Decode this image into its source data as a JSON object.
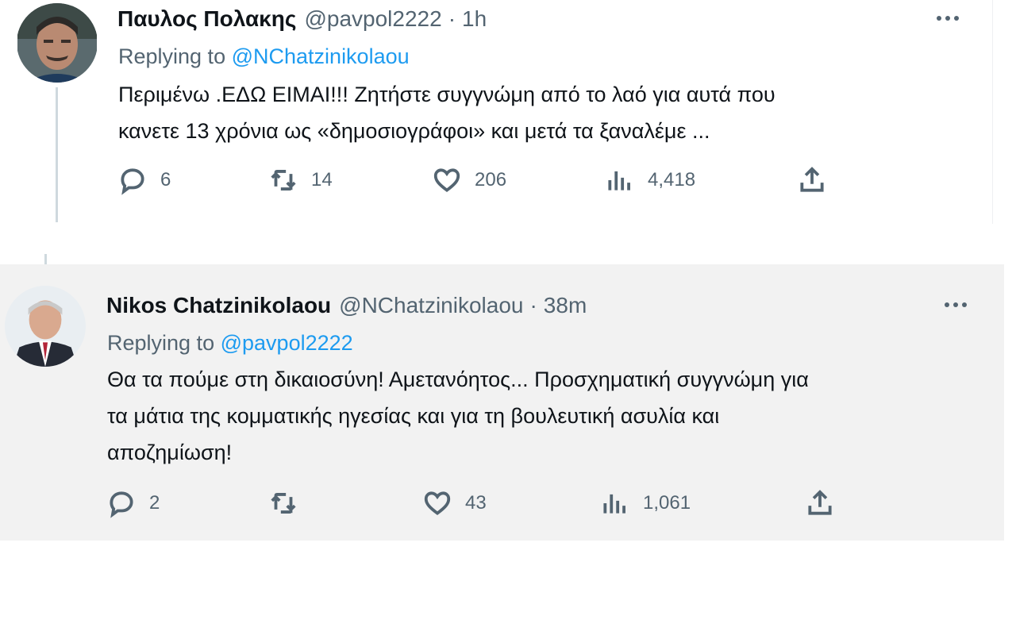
{
  "tweets": [
    {
      "display_name": "Παυλος Πολακης",
      "handle": "@pavpol2222",
      "separator": "·",
      "time": "1h",
      "replying_prefix": "Replying to",
      "replying_to": "@NChatzinikolaou",
      "body_lines": [
        "Περιμένω .ΕΔΩ ΕΙΜΑΙ!!! Ζητήστε συγγνώμη από το λαό για αυτά που",
        "κανετε 13 χρόνια ως «δημοσιογράφοι» και μετά τα ξαναλέμε ..."
      ],
      "replies": "6",
      "retweets": "14",
      "likes": "206",
      "views": "4,418"
    },
    {
      "display_name": "Nikos Chatzinikolaou",
      "handle": "@NChatzinikolaou",
      "separator": "·",
      "time": "38m",
      "replying_prefix": "Replying to",
      "replying_to": "@pavpol2222",
      "body_lines": [
        "Θα τα πούμε στη δικαιοσύνη! Αμετανόητος... Προσχηματική συγγνώμη για",
        "τα μάτια της κομματικής ηγεσίας και για τη βουλευτική ασυλία και",
        "αποζημίωση!"
      ],
      "replies": "2",
      "retweets": "",
      "likes": "43",
      "views": "1,061"
    }
  ],
  "icons": {
    "reply": "reply-icon",
    "retweet": "retweet-icon",
    "like": "heart-icon",
    "views": "views-icon",
    "share": "share-icon",
    "more": "more-icon"
  },
  "colors": {
    "link": "#1d9bf0",
    "secondary_text": "#536471",
    "primary_text": "#0f1419",
    "highlight_background": "#f2f2f2"
  }
}
